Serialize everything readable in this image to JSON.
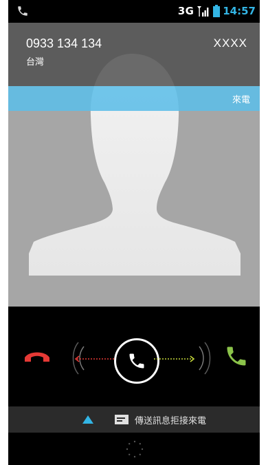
{
  "status_bar": {
    "network": "3G",
    "time": "14:57",
    "time_color": "#33b5e5",
    "icons": [
      "phone-icon",
      "signal-icon",
      "battery-icon"
    ]
  },
  "caller": {
    "number": "0933 134 134",
    "location": "台灣",
    "name": "XXXX"
  },
  "incoming_banner": {
    "label": "來電",
    "color": "#5dbee8"
  },
  "controls": {
    "decline_color": "#e53935",
    "answer_color": "#8bc34a",
    "icons": [
      "decline-call-icon",
      "answer-call-icon",
      "phone-handle-icon"
    ]
  },
  "message_bar": {
    "label": "傳送訊息拒接來電",
    "icons": [
      "up-arrow-icon",
      "message-icon"
    ]
  }
}
